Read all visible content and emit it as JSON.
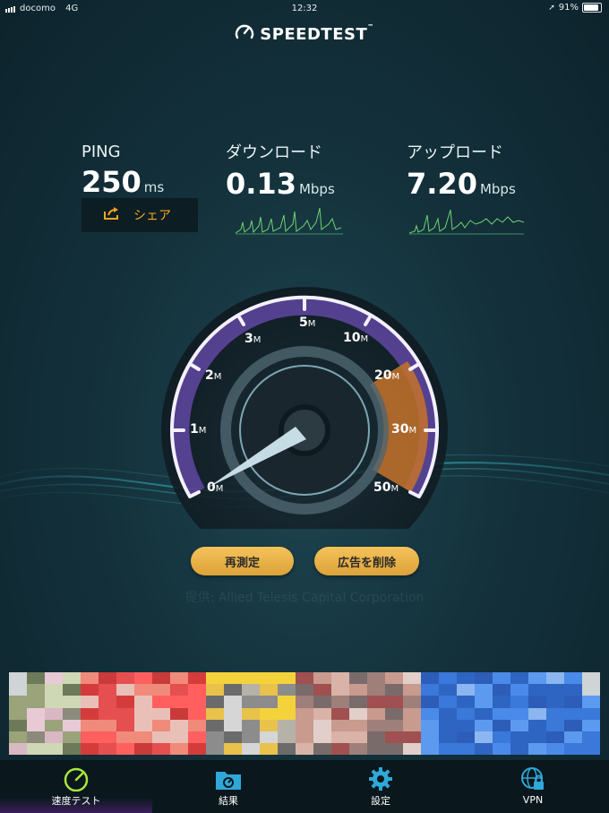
{
  "status_bar": {
    "carrier": "docomo",
    "network": "4G",
    "time": "12:32",
    "battery": "91%"
  },
  "logo": {
    "text": "SPEEDTEST",
    "tm": "™"
  },
  "metrics": {
    "ping": {
      "label": "PING",
      "value": "250",
      "unit": "ms"
    },
    "download": {
      "label": "ダウンロード",
      "value": "0.13",
      "unit": "Mbps"
    },
    "upload": {
      "label": "アップロード",
      "value": "7.20",
      "unit": "Mbps"
    }
  },
  "share_button": {
    "label": "シェア"
  },
  "gauge": {
    "labels": [
      {
        "num": "0",
        "unit": "M"
      },
      {
        "num": "1",
        "unit": "M"
      },
      {
        "num": "2",
        "unit": "M"
      },
      {
        "num": "3",
        "unit": "M"
      },
      {
        "num": "5",
        "unit": "M"
      },
      {
        "num": "10",
        "unit": "M"
      },
      {
        "num": "20",
        "unit": "M"
      },
      {
        "num": "30",
        "unit": "M"
      },
      {
        "num": "50",
        "unit": "M"
      }
    ]
  },
  "buttons": {
    "retest": "再測定",
    "remove_ads": "広告を削除"
  },
  "host": "提供: Allied Telesis Capital Corporation",
  "tabs": [
    {
      "label": "速度テスト",
      "icon": "speedometer-icon",
      "active": true
    },
    {
      "label": "結果",
      "icon": "results-folder-icon",
      "active": false
    },
    {
      "label": "設定",
      "icon": "gear-icon",
      "active": false
    },
    {
      "label": "VPN",
      "icon": "vpn-globe-lock-icon",
      "active": false
    }
  ],
  "colors": {
    "accent_orange": "#f5a623",
    "gauge_purple": "#8a5ce6",
    "active_tab": "#3a1e5a"
  }
}
